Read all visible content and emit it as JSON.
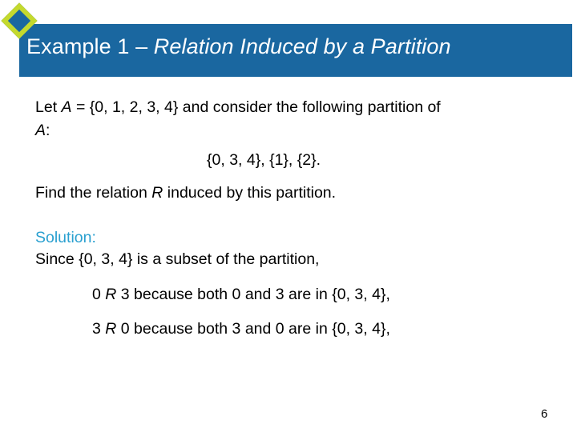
{
  "slide": {
    "title_plain": "Example 1 – ",
    "title_italic": "Relation Induced by a Partition",
    "colors": {
      "banner": "#1a67a0",
      "accent_diamond": "#c4d92e",
      "solution": "#2aa0d0"
    },
    "paragraphs": {
      "line1_pre": "Let ",
      "line1_var": "A",
      "line1_post": " = {0, 1, 2, 3, 4} and consider the following partition of",
      "line2_var": "A",
      "line2_post": ":",
      "partition": "{0, 3, 4}, {1}, {2}.",
      "find_pre": "Find the relation ",
      "find_var": "R",
      "find_post": " induced by this partition.",
      "solution_label": "Solution:",
      "since": "Since {0, 3, 4} is a subset of the partition,",
      "rel1_a": "0 ",
      "rel1_r": "R",
      "rel1_b": " 3 because both 0 and 3 are in {0, 3, 4},",
      "rel2_a": "3 ",
      "rel2_r": "R",
      "rel2_b": " 0 because both 3 and 0 are in {0, 3, 4},"
    },
    "page_number": "6"
  }
}
